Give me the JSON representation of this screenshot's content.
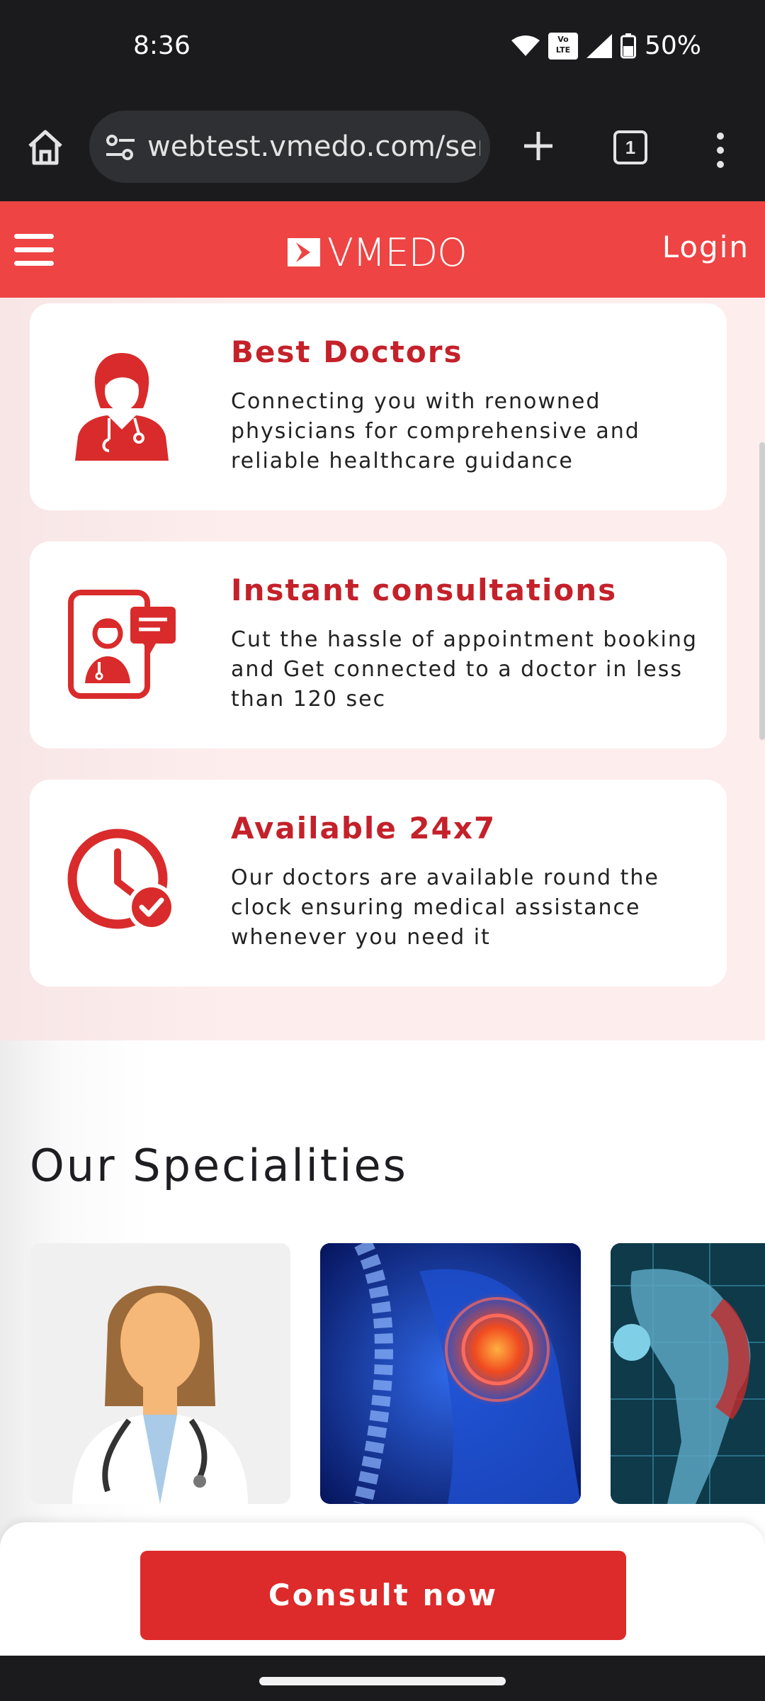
{
  "status_bar": {
    "time": "8:36",
    "volte": "Vo LTE",
    "battery": "50%"
  },
  "browser": {
    "url": "webtest.vmedo.com/services",
    "tab_count": "1"
  },
  "site_header": {
    "logo_text": "VMEDO",
    "login_label": "Login",
    "brand_color": "#ee4444"
  },
  "features": [
    {
      "title": "Best Doctors",
      "description": "Connecting you with renowned physicians for comprehensive and reliable healthcare guidance",
      "icon": "female-doctor-icon"
    },
    {
      "title": "Instant consultations",
      "description": "Cut the hassle of appointment booking and Get connected to a doctor in less than 120 sec",
      "icon": "video-consult-icon"
    },
    {
      "title": "Available 24x7",
      "description": "Our doctors are available round the clock ensuring medical assistance whenever you need it",
      "icon": "clock-check-icon"
    }
  ],
  "specialities": {
    "title": "Our Specialities",
    "cards": [
      {
        "image": "general-physician-image"
      },
      {
        "image": "orthopedics-image"
      },
      {
        "image": "gynecology-image"
      }
    ]
  },
  "cta": {
    "label": "Consult now",
    "color": "#dd2a2a"
  }
}
